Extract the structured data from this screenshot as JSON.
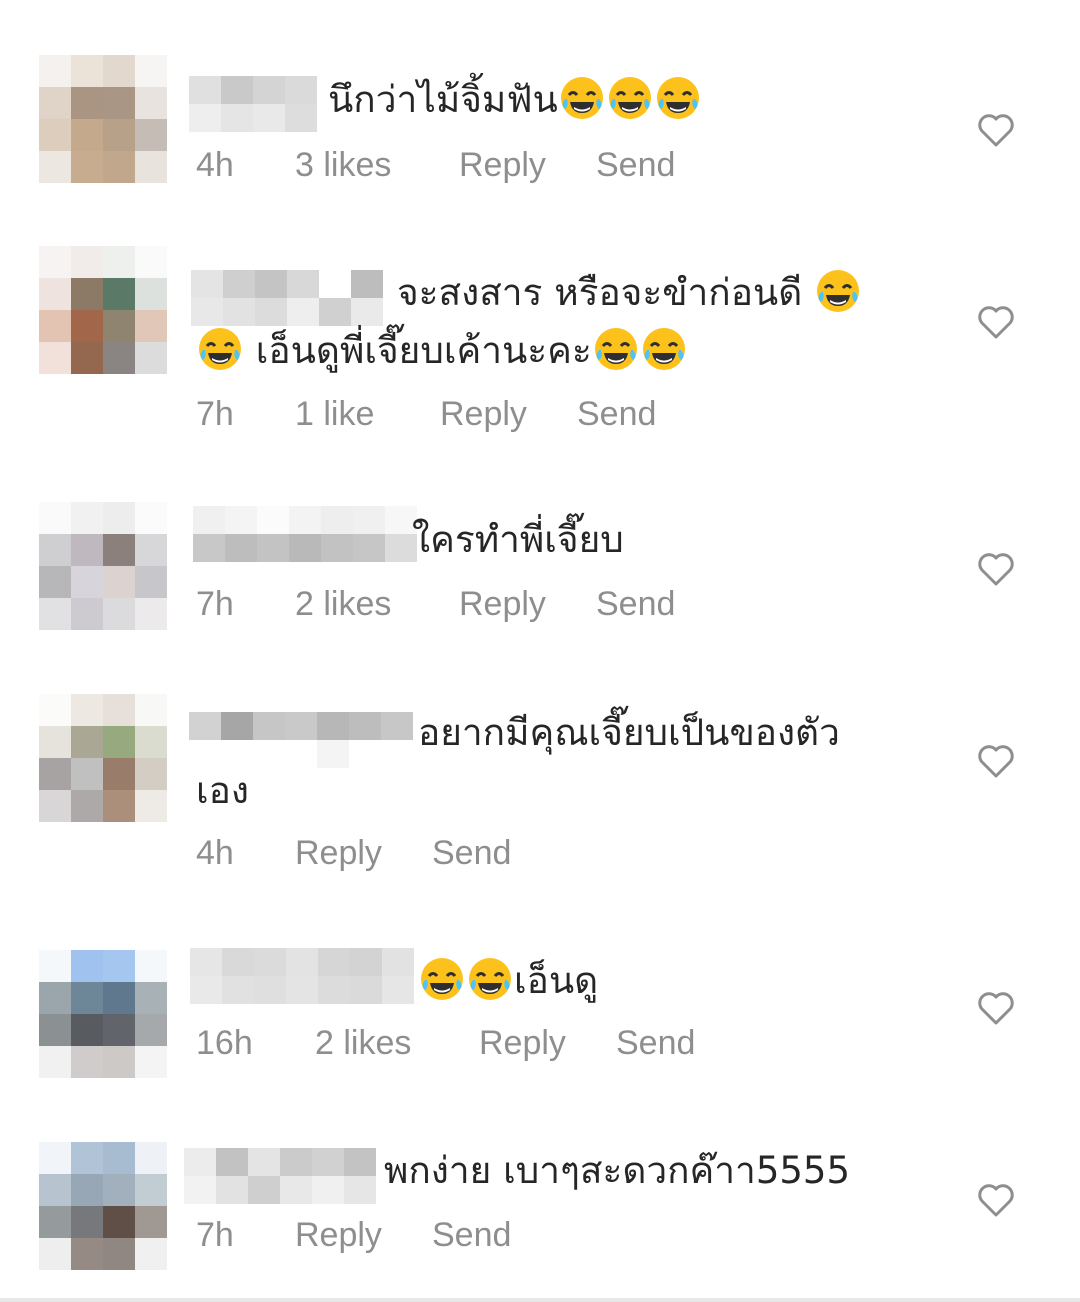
{
  "comments": [
    {
      "text_before": "",
      "emojis_before": 0,
      "text": "นึกว่าไม้จิ้มฟัน",
      "emojis_after": 3,
      "line2_emojis": 0,
      "line2": "",
      "time": "4h",
      "likes": "3 likes",
      "reply": "Reply",
      "send": "Send"
    },
    {
      "text": "จะสงสาร หรือจะขำก่อนดี",
      "emojis_after": 1,
      "line2_emojis": 1,
      "line2": " เอ็นดูพี่เจี๊ยบเค้านะคะ",
      "line2_emojis_after": 2,
      "time": "7h",
      "likes": "1 like",
      "reply": "Reply",
      "send": "Send"
    },
    {
      "text": "ใครทำพี่เจี๊ยบ",
      "emojis_after": 0,
      "time": "7h",
      "likes": "2 likes",
      "reply": "Reply",
      "send": "Send"
    },
    {
      "text": "อยากมีคุณเจี๊ยบเป็นของตัว",
      "emojis_after": 0,
      "line2": "เอง",
      "time": "4h",
      "likes": "",
      "reply": "Reply",
      "send": "Send"
    },
    {
      "text_prefix_emojis": 2,
      "text": "เอ็นดู",
      "time": "16h",
      "likes": "2 likes",
      "reply": "Reply",
      "send": "Send"
    },
    {
      "text": "พกง่าย เบาๆสะดวกค๊าา5555",
      "time": "7h",
      "likes": "",
      "reply": "Reply",
      "send": "Send"
    }
  ],
  "icons": {
    "heart": "heart-outline-icon",
    "emoji": "face-with-tears-of-joy-icon"
  },
  "colors": {
    "text": "#262626",
    "meta": "#8e8e8e",
    "heart": "#8e8e8e"
  }
}
